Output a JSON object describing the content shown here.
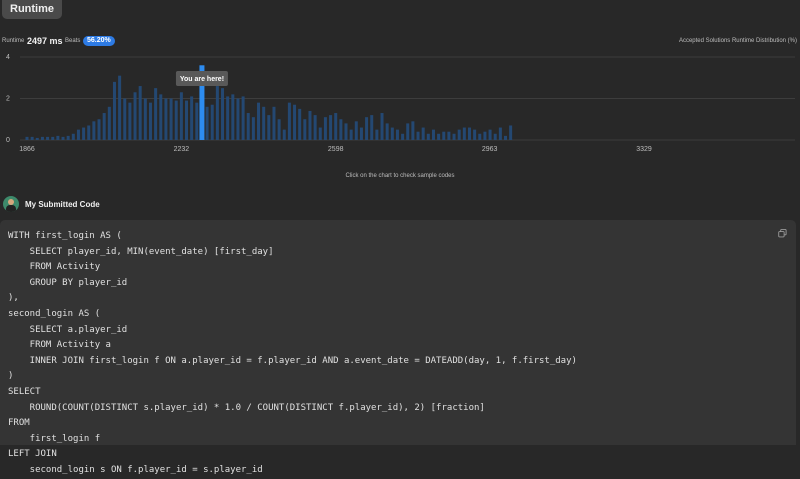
{
  "tab": {
    "label": "Runtime"
  },
  "stats": {
    "runtime_label": "Runtime",
    "runtime_value": "2497 ms",
    "beats_label": "Beats",
    "beats_value": "56.20%",
    "distribution_title": "Accepted Solutions Runtime Distribution (%)"
  },
  "chart_data": {
    "type": "bar",
    "ylim": [
      0,
      4
    ],
    "y_ticks": [
      "0",
      "2",
      "4"
    ],
    "x_ticks": [
      {
        "label": "1866",
        "value": 1866
      },
      {
        "label": "2232",
        "value": 2232
      },
      {
        "label": "2598",
        "value": 2598
      },
      {
        "label": "2963",
        "value": 2963
      },
      {
        "label": "3329",
        "value": 3329
      }
    ],
    "bin_width": 12.2,
    "values": [
      0.15,
      0.15,
      0.1,
      0.15,
      0.15,
      0.15,
      0.2,
      0.15,
      0.2,
      0.3,
      0.5,
      0.6,
      0.7,
      0.9,
      1.0,
      1.3,
      1.6,
      2.8,
      3.1,
      2.0,
      1.8,
      2.3,
      2.6,
      2.0,
      1.8,
      2.5,
      2.2,
      2.0,
      2.0,
      1.9,
      2.3,
      1.9,
      2.1,
      1.8,
      3.6,
      1.6,
      1.7,
      2.6,
      2.5,
      2.1,
      2.2,
      2.0,
      2.1,
      1.3,
      1.1,
      1.8,
      1.6,
      1.2,
      1.6,
      1.0,
      0.5,
      1.8,
      1.7,
      1.5,
      1.0,
      1.4,
      1.2,
      0.6,
      1.1,
      1.2,
      1.3,
      1.0,
      0.8,
      0.5,
      0.9,
      0.6,
      1.1,
      1.2,
      0.5,
      1.3,
      0.8,
      0.6,
      0.5,
      0.3,
      0.8,
      0.9,
      0.4,
      0.6,
      0.3,
      0.5,
      0.3,
      0.4,
      0.4,
      0.3,
      0.5,
      0.6,
      0.6,
      0.5,
      0.3,
      0.4,
      0.5,
      0.3,
      0.6,
      0.2,
      0.7
    ],
    "highlight_index": 34,
    "highlight_label": "You are here!",
    "grid": true,
    "colors": {
      "bar": "#244872",
      "highlight": "#2d8cf0",
      "grid": "#444444",
      "tooltip_bg": "#595959"
    },
    "hint": "Click on the chart to check sample codes"
  },
  "code": {
    "title": "My Submitted Code",
    "lines": [
      "WITH first_login AS (",
      "    SELECT player_id, MIN(event_date) [first_day]",
      "    FROM Activity",
      "    GROUP BY player_id",
      "),",
      "second_login AS (",
      "    SELECT a.player_id",
      "    FROM Activity a",
      "    INNER JOIN first_login f ON a.player_id = f.player_id AND a.event_date = DATEADD(day, 1, f.first_day)",
      ")",
      "SELECT",
      "    ROUND(COUNT(DISTINCT s.player_id) * 1.0 / COUNT(DISTINCT f.player_id), 2) [fraction]",
      "FROM",
      "    first_login f",
      "LEFT JOIN",
      "    second_login s ON f.player_id = s.player_id"
    ]
  },
  "icons": {
    "copy": "copy-icon",
    "avatar": "avatar"
  }
}
